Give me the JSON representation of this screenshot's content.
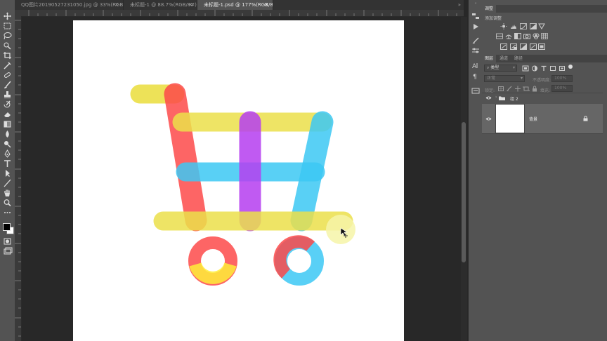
{
  "tabs": [
    {
      "label": "QQ图片20190527231050.jpg @ 33%(RGB/8#)",
      "close": "✕",
      "active": false
    },
    {
      "label": "未标题-1 @ 88.7%(RGB/8#) *",
      "close": "✕",
      "active": false
    },
    {
      "label": "未标题-1.psd @ 177%(RGB/8#)",
      "close": "✕",
      "active": true
    }
  ],
  "adjustments": {
    "tab": "调整",
    "heading": "添加调整"
  },
  "layers_panel": {
    "tabs": [
      "图层",
      "通道",
      "路径"
    ],
    "filter_kind": "类型",
    "blend_mode": "正常",
    "opacity_label": "不透明度:",
    "opacity_value": "100%",
    "lock_label": "锁定:",
    "fill_label": "填充:",
    "fill_value": "100%",
    "layers": [
      {
        "name": "组 2",
        "type": "group",
        "visible": true
      },
      {
        "name": "背景",
        "type": "background",
        "visible": true,
        "locked": true
      }
    ]
  },
  "canvas_art": {
    "colors": {
      "yellow": "#ece04a",
      "red": "#fd4a4a",
      "purple": "#b63ef0",
      "cyan": "#3cc8f4",
      "pale_yellow": "#f6f5a8"
    }
  },
  "ui_colors": {
    "panel_bg": "#535353",
    "workspace_bg": "#282828",
    "document_bg": "#ffffff"
  }
}
